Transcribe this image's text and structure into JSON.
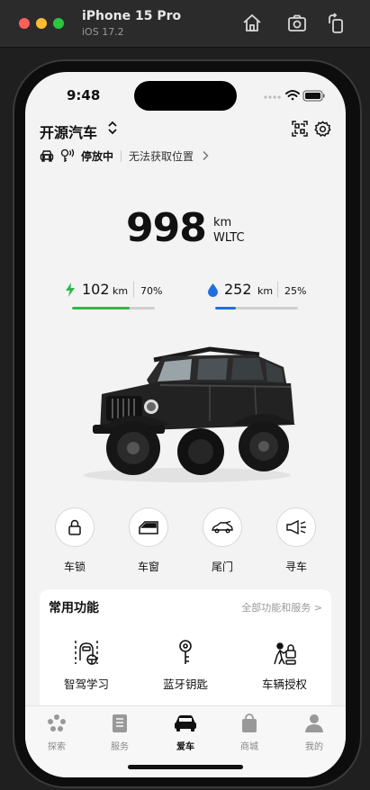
{
  "simulator": {
    "device": "iPhone 15 Pro",
    "os": "iOS 17.2"
  },
  "status_bar": {
    "time": "9:48"
  },
  "header": {
    "car_name": "开源汽车",
    "park_status": "停放中",
    "location": "无法获取位置"
  },
  "range": {
    "value": "998",
    "unit": "km",
    "standard": "WLTC"
  },
  "electric": {
    "range": "102",
    "unit": "km",
    "percent": "70%",
    "level": 0.7,
    "color": "#2db84c"
  },
  "fuel": {
    "range": "252",
    "unit": "km",
    "percent": "25%",
    "level": 0.25,
    "color": "#1f6fe0"
  },
  "quick_actions": [
    {
      "label": "车锁"
    },
    {
      "label": "车窗"
    },
    {
      "label": "尾门"
    },
    {
      "label": "寻车"
    }
  ],
  "common": {
    "title": "常用功能",
    "all_link": "全部功能和服务 >",
    "items": [
      {
        "label": "智驾学习"
      },
      {
        "label": "蓝牙钥匙"
      },
      {
        "label": "车辆授权"
      }
    ]
  },
  "tabbar": [
    {
      "label": "探索"
    },
    {
      "label": "服务"
    },
    {
      "label": "爱车"
    },
    {
      "label": "商城"
    },
    {
      "label": "我的"
    }
  ]
}
